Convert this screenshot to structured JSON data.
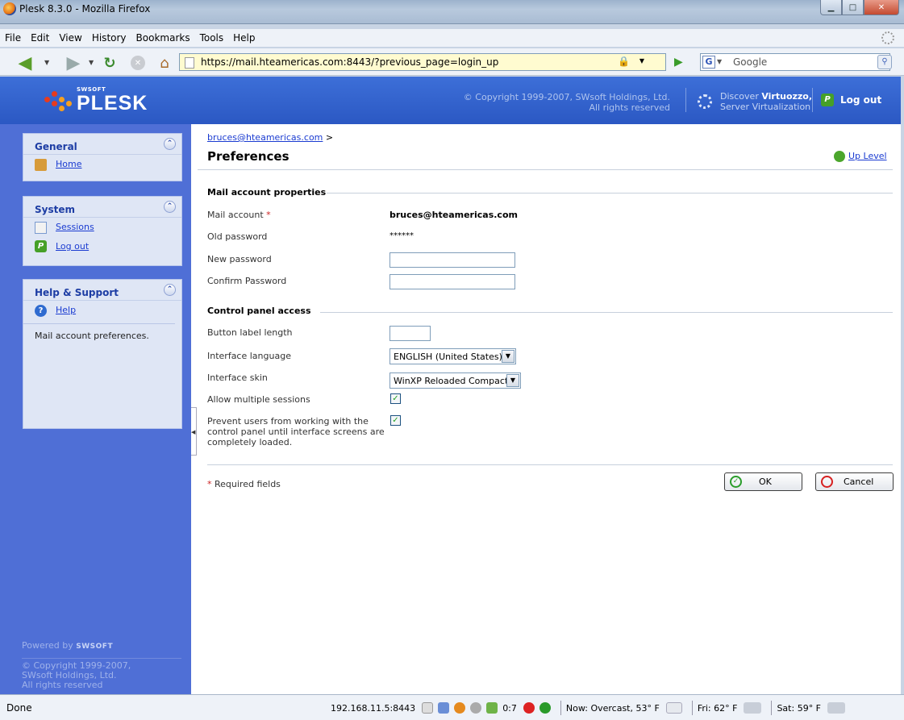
{
  "window": {
    "title": "Plesk 8.3.0 - Mozilla Firefox"
  },
  "menu": [
    "File",
    "Edit",
    "View",
    "History",
    "Bookmarks",
    "Tools",
    "Help"
  ],
  "nav": {
    "url": "https://mail.hteamericas.com:8443/?previous_page=login_up",
    "search_placeholder": "Google"
  },
  "header": {
    "logo_small": "SWSOFT",
    "logo": "PLESK",
    "copyright_line1": "© Copyright 1999-2007, SWsoft Holdings, Ltd.",
    "copyright_line2": "All rights reserved",
    "discover_prefix": "Discover ",
    "discover_bold": "Virtuozzo,",
    "discover_line2": "Server Virtualization",
    "logout": "Log out"
  },
  "sidebar": {
    "general": {
      "title": "General",
      "items": [
        "Home"
      ]
    },
    "system": {
      "title": "System",
      "items": [
        "Sessions",
        "Log out"
      ]
    },
    "help": {
      "title": "Help & Support",
      "items": [
        "Help"
      ],
      "description": "Mail account preferences."
    },
    "powered_prefix": "Powered by ",
    "powered_brand": "SWSOFT",
    "copyright": [
      "© Copyright 1999-2007,",
      "SWsoft Holdings, Ltd.",
      "All rights reserved"
    ]
  },
  "main": {
    "breadcrumb_link": "bruces@hteamericas.com",
    "breadcrumb_sep": " >",
    "title": "Preferences",
    "up_level": "Up Level",
    "mail_section": "Mail account properties",
    "fields": {
      "mail_account_label": "Mail account",
      "mail_account_value": "bruces@hteamericas.com",
      "old_password_label": "Old password",
      "old_password_value": "******",
      "new_password_label": "New password",
      "confirm_password_label": "Confirm Password"
    },
    "access_section": "Control panel access",
    "access": {
      "button_label_length": "Button label length",
      "interface_language": "Interface language",
      "interface_language_value": "ENGLISH (United States)",
      "interface_skin": "Interface skin",
      "interface_skin_value": "WinXP Reloaded Compact",
      "allow_multiple_sessions": "Allow multiple sessions",
      "allow_multiple_sessions_checked": true,
      "prevent_users_line1": "Prevent users from working with the",
      "prevent_users_line2": "control panel until interface screens are",
      "prevent_users_line3": "completely loaded.",
      "prevent_users_checked": true
    },
    "required_star": "*",
    "required_text": " Required fields",
    "ok": "OK",
    "cancel": "Cancel"
  },
  "status": {
    "done": "Done",
    "ip": "192.168.11.5:8443",
    "counter": "0:7",
    "weather_now": "Now: Overcast, 53° F",
    "weather_fri": "Fri: 62° F",
    "weather_sat": "Sat: 59° F"
  },
  "colors": {
    "brand_blue": "#2b58c3",
    "sidebar_blue": "#4f6fd6",
    "link": "#1a3bd1"
  }
}
